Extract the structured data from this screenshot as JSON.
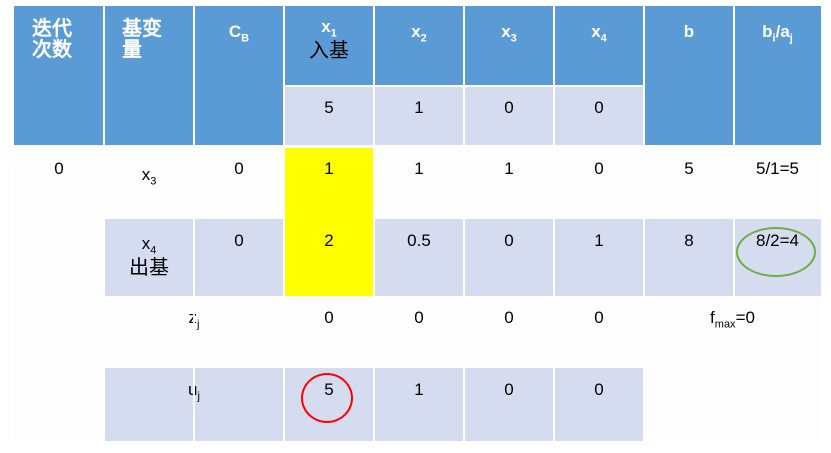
{
  "header": {
    "iter": "迭代次数",
    "basis": "基变量",
    "cb": {
      "main": "C",
      "sub": "B"
    },
    "x1": {
      "main": "x",
      "sub": "1",
      "note": "入基"
    },
    "x2": {
      "main": "x",
      "sub": "2"
    },
    "x3": {
      "main": "x",
      "sub": "3"
    },
    "x4": {
      "main": "x",
      "sub": "4"
    },
    "b": "b",
    "ratio": {
      "p1": "b",
      "s1": "i",
      "p2": "/a",
      "s2": "j"
    }
  },
  "obj_coeffs": [
    "5",
    "1",
    "0",
    "0"
  ],
  "rows": [
    {
      "iter": "0",
      "basis": {
        "main": "x",
        "sub": "3"
      },
      "cb": "0",
      "values": [
        "1",
        "1",
        "1",
        "0"
      ],
      "b": "5",
      "ratio": "5/1=5"
    },
    {
      "basis": {
        "main": "x",
        "sub": "4",
        "note": "出基"
      },
      "cb": "0",
      "values": [
        "2",
        "0.5",
        "0",
        "1"
      ],
      "b": "8",
      "ratio": "8/2=4"
    }
  ],
  "zj": {
    "label": {
      "main": "z",
      "sub": "j"
    },
    "values": [
      "0",
      "0",
      "0",
      "0"
    ],
    "fmax": {
      "main": "f",
      "sub": "max",
      "value": "=0"
    }
  },
  "uj": {
    "label": {
      "main": "u",
      "sub": "j"
    },
    "values": [
      "5",
      "1",
      "0",
      "0"
    ]
  },
  "colors": {
    "header": "#5b9bd5",
    "light_row": "#d5dcef",
    "pivot": "#ffff00",
    "circle_red": "#ff0000",
    "circle_green": "#70ad47"
  }
}
